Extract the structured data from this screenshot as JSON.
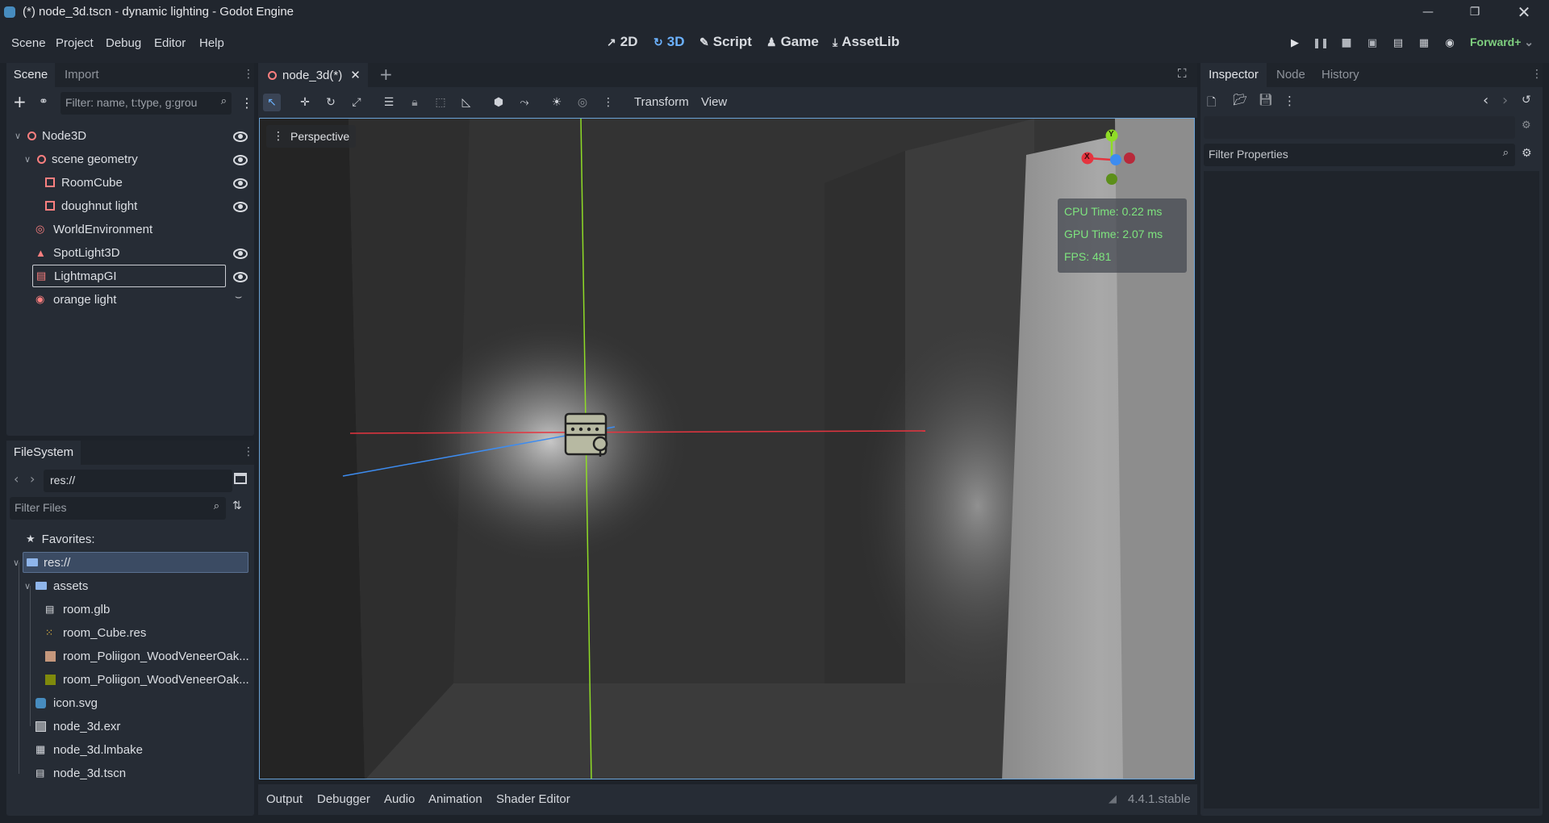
{
  "window": {
    "title": "(*) node_3d.tscn - dynamic lighting - Godot Engine",
    "controls": [
      "minimize-icon",
      "restore-icon",
      "close-icon"
    ]
  },
  "menus": [
    "Scene",
    "Project",
    "Debug",
    "Editor",
    "Help"
  ],
  "workspaces": {
    "tab_2d": "2D",
    "tab_3d": "3D",
    "tab_script": "Script",
    "tab_game": "Game",
    "tab_assetlib": "AssetLib",
    "active": "3D"
  },
  "renderer": "Forward+",
  "scene_dock": {
    "tabs": [
      "Scene",
      "Import"
    ],
    "filter_placeholder": "Filter: name, t:type, g:grou",
    "nodes": [
      {
        "name": "Node3D",
        "icon": "node3d-icon",
        "visible_toggle": true
      },
      {
        "name": "scene geometry",
        "icon": "node3d-icon",
        "visible_toggle": true
      },
      {
        "name": "RoomCube",
        "icon": "mesh-icon",
        "visible_toggle": true
      },
      {
        "name": "doughnut light",
        "icon": "mesh-icon",
        "visible_toggle": true
      },
      {
        "name": "WorldEnvironment",
        "icon": "globe-icon",
        "visible_toggle": false
      },
      {
        "name": "SpotLight3D",
        "icon": "spotlight-icon",
        "visible_toggle": true
      },
      {
        "name": "LightmapGI",
        "icon": "lightmap-icon",
        "visible_toggle": true
      },
      {
        "name": "orange light",
        "icon": "omnilight-icon",
        "visible_toggle": false
      }
    ]
  },
  "filesystem_dock": {
    "tab": "FileSystem",
    "path": "res://",
    "filter_placeholder": "Filter Files",
    "favorites_label": "Favorites:",
    "items": [
      {
        "name": "res://",
        "icon": "folder-icon"
      },
      {
        "name": "assets",
        "icon": "folder-icon"
      },
      {
        "name": "room.glb",
        "icon": "scene-icon"
      },
      {
        "name": "room_Cube.res",
        "icon": "mesh-resource-icon"
      },
      {
        "name": "room_Poliigon_WoodVeneerOak...",
        "icon": "material-icon"
      },
      {
        "name": "room_Poliigon_WoodVeneerOak...",
        "icon": "material-icon"
      },
      {
        "name": "icon.svg",
        "icon": "svg-icon"
      },
      {
        "name": "node_3d.exr",
        "icon": "image-icon"
      },
      {
        "name": "node_3d.lmbake",
        "icon": "lightmap-data-icon"
      },
      {
        "name": "node_3d.tscn",
        "icon": "scene-icon"
      }
    ]
  },
  "editor_tab": {
    "label": "node_3d(*)"
  },
  "viewport_toolbar": {
    "transform": "Transform",
    "view": "View"
  },
  "viewport": {
    "perspective_label": "Perspective",
    "gizmo": {
      "x": "X",
      "y": "Y"
    },
    "stats": {
      "cpu": "CPU Time: 0.22 ms",
      "gpu": "GPU Time: 2.07 ms",
      "fps": "FPS: 481"
    },
    "colors": {
      "x_axis": "#e5343f",
      "y_axis": "#8fdc26",
      "z_axis": "#3d8cf0"
    }
  },
  "bottom_panel": {
    "tabs": [
      "Output",
      "Debugger",
      "Audio",
      "Animation",
      "Shader Editor"
    ],
    "version": "4.4.1.stable"
  },
  "inspector": {
    "tabs": [
      "Inspector",
      "Node",
      "History"
    ],
    "filter_placeholder": "Filter Properties"
  }
}
